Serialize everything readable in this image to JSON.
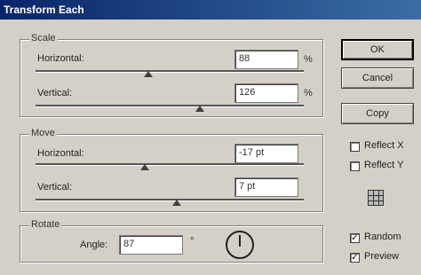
{
  "window": {
    "title": "Transform Each"
  },
  "scale": {
    "title": "Scale",
    "horizontal": {
      "label": "Horizontal:",
      "value": "88",
      "unit": "%",
      "slider_level": 0.38
    },
    "vertical": {
      "label": "Vertical:",
      "value": "126",
      "unit": "%",
      "slider_level": 0.62
    }
  },
  "move": {
    "title": "Move",
    "horizontal": {
      "label": "Horizontal:",
      "value": "-17 pt",
      "slider_level": 0.42
    },
    "vertical": {
      "label": "Vertical:",
      "value": "7 pt",
      "slider_level": 0.52
    }
  },
  "rotate": {
    "title": "Rotate",
    "angle": {
      "label": "Angle:",
      "value": "87",
      "unit": "°"
    }
  },
  "buttons": {
    "ok": "OK",
    "cancel": "Cancel",
    "copy": "Copy"
  },
  "options": {
    "reflect_x": {
      "label": "Reflect X",
      "checked": false
    },
    "reflect_y": {
      "label": "Reflect Y",
      "checked": false
    },
    "random": {
      "label": "Random",
      "checked": true
    },
    "preview": {
      "label": "Preview",
      "checked": true
    }
  },
  "icons": {
    "reference_point": "reference-point-grid-icon",
    "dial": "angle-dial-icon"
  }
}
